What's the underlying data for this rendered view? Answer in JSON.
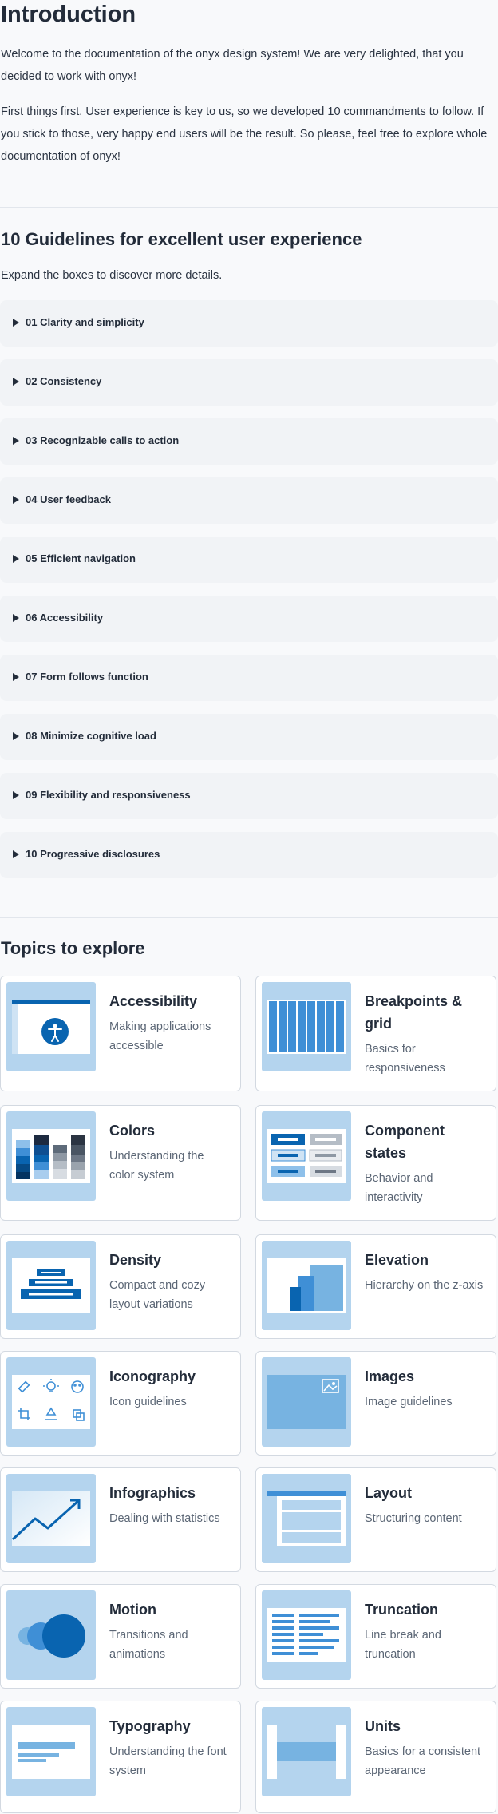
{
  "intro": {
    "title": "Introduction",
    "p1": "Welcome to the documentation of the onyx design system! We are very delighted, that you decided to work with onyx!",
    "p2": "First things first. User experience is key to us, so we developed 10 commandments to follow. If you stick to those, very happy end users will be the result. So please, feel free to explore whole documentation of onyx!"
  },
  "guidelines": {
    "title": "10 Guidelines for excellent user experience",
    "subtitle": "Expand the boxes to discover more details.",
    "items": [
      "01 Clarity and simplicity",
      "02 Consistency",
      "03 Recognizable calls to action",
      "04 User feedback",
      "05 Efficient navigation",
      "06 Accessibility",
      "07 Form follows function",
      "08 Minimize cognitive load",
      "09 Flexibility and responsiveness",
      "10 Progressive disclosures"
    ]
  },
  "topics": {
    "title": "Topics to explore",
    "cards": [
      {
        "title": "Accessibility",
        "desc": "Making applications accessible",
        "icon": "accessibility-icon"
      },
      {
        "title": "Breakpoints & grid",
        "desc": "Basics for responsiveness",
        "icon": "grid-icon"
      },
      {
        "title": "Colors",
        "desc": "Understanding the color system",
        "icon": "color-palette-icon"
      },
      {
        "title": "Component states",
        "desc": "Behavior and interactivity",
        "icon": "component-states-icon"
      },
      {
        "title": "Density",
        "desc": "Compact and cozy layout variations",
        "icon": "density-icon"
      },
      {
        "title": "Elevation",
        "desc": "Hierarchy on the z-axis",
        "icon": "elevation-icon"
      },
      {
        "title": "Iconography",
        "desc": "Icon guidelines",
        "icon": "icons-icon"
      },
      {
        "title": "Images",
        "desc": "Image guidelines",
        "icon": "image-icon"
      },
      {
        "title": "Infographics",
        "desc": "Dealing with statistics",
        "icon": "chart-icon"
      },
      {
        "title": "Layout",
        "desc": "Structuring content",
        "icon": "layout-icon"
      },
      {
        "title": "Motion",
        "desc": "Transitions and animations",
        "icon": "motion-icon"
      },
      {
        "title": "Truncation",
        "desc": "Line break and truncation",
        "icon": "truncation-icon"
      },
      {
        "title": "Typography",
        "desc": "Understanding the font system",
        "icon": "typography-icon"
      },
      {
        "title": "Units",
        "desc": "Basics for a consistent appearance",
        "icon": "units-icon"
      }
    ]
  },
  "colors": {
    "accent": "#0964b0",
    "accent_light": "#b4d4ee",
    "accent_mid": "#77b3e1",
    "text": "#232c3a",
    "muted": "#5b6675"
  }
}
